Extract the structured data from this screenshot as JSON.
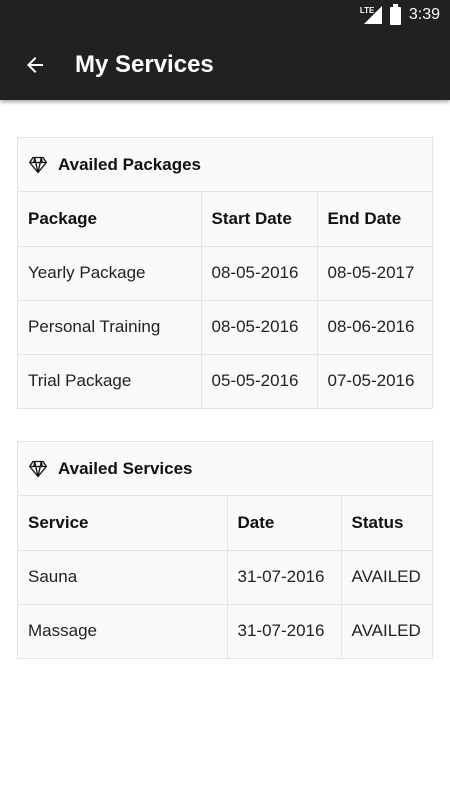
{
  "status_bar": {
    "network": "LTE",
    "time": "3:39"
  },
  "app_bar": {
    "title": "My Services",
    "back_icon": "arrow-left-icon"
  },
  "packages": {
    "title": "Availed Packages",
    "icon": "diamond-icon",
    "headers": [
      "Package",
      "Start Date",
      "End Date"
    ],
    "rows": [
      [
        "Yearly Package",
        "08-05-2016",
        "08-05-2017"
      ],
      [
        "Personal Training",
        "08-05-2016",
        "08-06-2016"
      ],
      [
        "Trial Package",
        "05-05-2016",
        "07-05-2016"
      ]
    ]
  },
  "services": {
    "title": "Availed Services",
    "icon": "diamond-icon",
    "headers": [
      "Service",
      "Date",
      "Status"
    ],
    "rows": [
      [
        "Sauna",
        "31-07-2016",
        "AVAILED"
      ],
      [
        "Massage",
        "31-07-2016",
        "AVAILED"
      ]
    ]
  }
}
